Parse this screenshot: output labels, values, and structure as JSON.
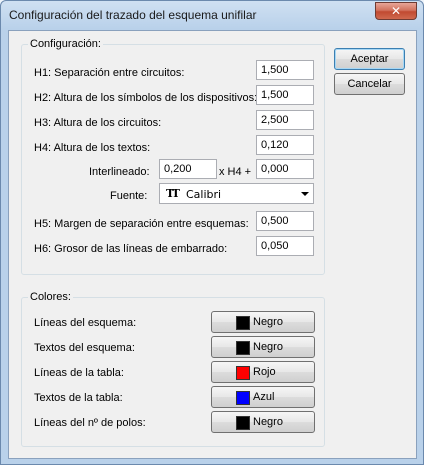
{
  "window": {
    "title": "Configuración del trazado del esquema unifilar",
    "close_symbol": "✕"
  },
  "buttons": {
    "accept_label": "Aceptar",
    "cancel_label": "Cancelar"
  },
  "config": {
    "group_label": "Configuración:",
    "h1": {
      "label": "H1: Separación entre circuitos:",
      "value": "1,500"
    },
    "h2": {
      "label": "H2: Altura de los símbolos de los dispositivos:",
      "value": "1,500"
    },
    "h3": {
      "label": "H3: Altura de los circuitos:",
      "value": "2,500"
    },
    "h4": {
      "label": "H4: Altura de los textos:",
      "value": "0,120"
    },
    "interlineado": {
      "label": "Interlineado:",
      "value": "0,200",
      "mult_label": "x H4 +",
      "offset_value": "0,000"
    },
    "fuente": {
      "label": "Fuente:",
      "icon": "truetype-font-icon",
      "value": "Calibri"
    },
    "h5": {
      "label": "H5: Margen de separación entre esquemas:",
      "value": "0,500"
    },
    "h6": {
      "label": "H6: Grosor de las líneas de embarrado:",
      "value": "0,050"
    }
  },
  "colors": {
    "group_label": "Colores:",
    "items": [
      {
        "label": "Líneas del esquema:",
        "color_name": "Negro",
        "color": "#000000"
      },
      {
        "label": "Textos del esquema:",
        "color_name": "Negro",
        "color": "#000000"
      },
      {
        "label": "Líneas de la tabla:",
        "color_name": "Rojo",
        "color": "#ff0000"
      },
      {
        "label": "Textos de la tabla:",
        "color_name": "Azul",
        "color": "#0000ff"
      },
      {
        "label": "Líneas del nº de polos:",
        "color_name": "Negro",
        "color": "#000000"
      }
    ]
  }
}
